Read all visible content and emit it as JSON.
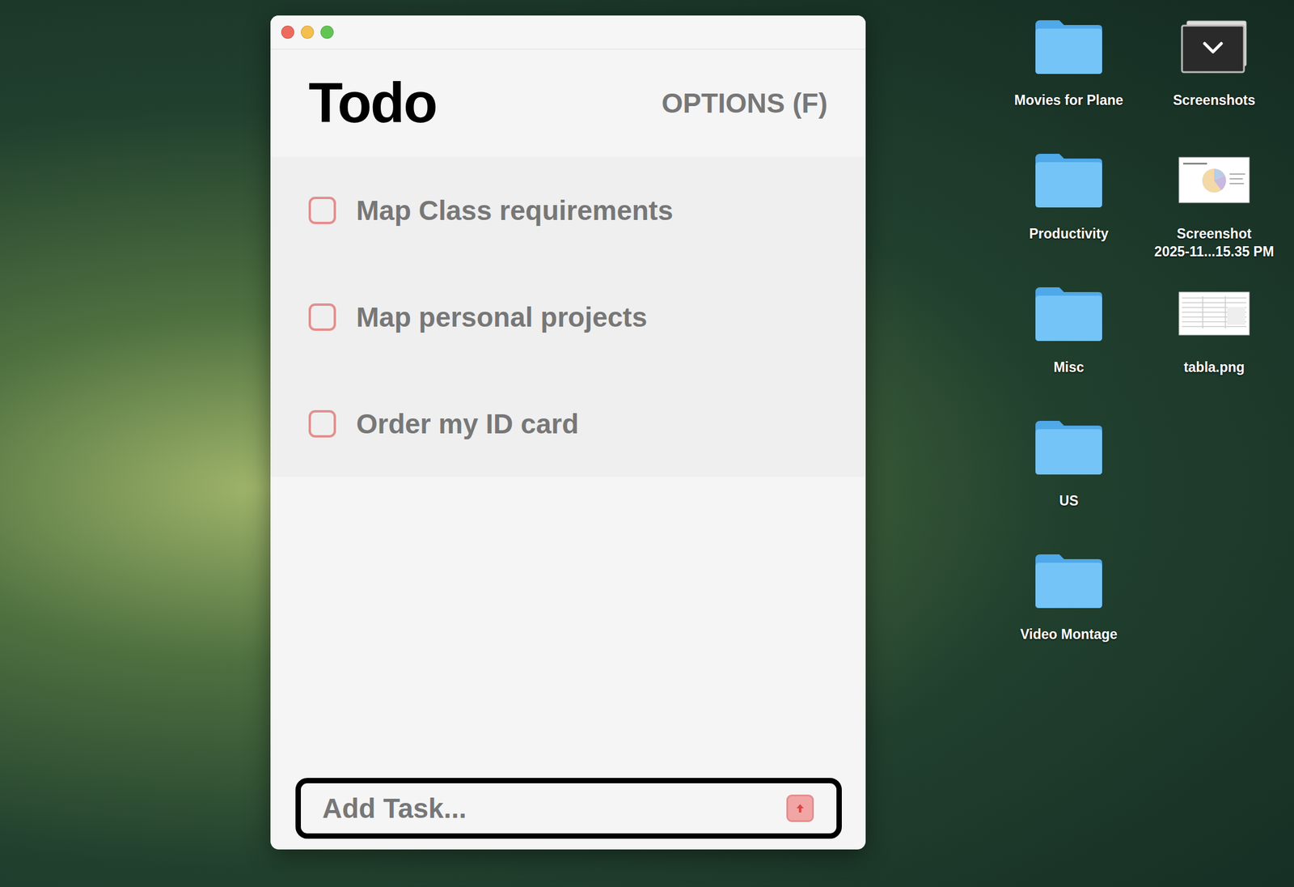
{
  "window": {
    "title": ""
  },
  "app": {
    "title": "Todo",
    "options": "OPTIONS (F)"
  },
  "tasks": [
    {
      "label": "Map Class requirements",
      "checked": false
    },
    {
      "label": "Map personal projects",
      "checked": false
    },
    {
      "label": "Order my ID card",
      "checked": false
    }
  ],
  "input": {
    "placeholder": "Add Task..."
  },
  "desktop_icons": [
    {
      "label": "Movies for Plane",
      "kind": "folder"
    },
    {
      "label": "Productivity",
      "kind": "folder"
    },
    {
      "label": "Misc",
      "kind": "folder"
    },
    {
      "label": "US",
      "kind": "folder"
    },
    {
      "label": "Video Montage",
      "kind": "folder"
    },
    {
      "label": "Screenshots",
      "kind": "stack"
    },
    {
      "label": "Screenshot\n2025-11...15.35 PM",
      "kind": "chart-image"
    },
    {
      "label": "tabla.png",
      "kind": "table-image"
    }
  ]
}
